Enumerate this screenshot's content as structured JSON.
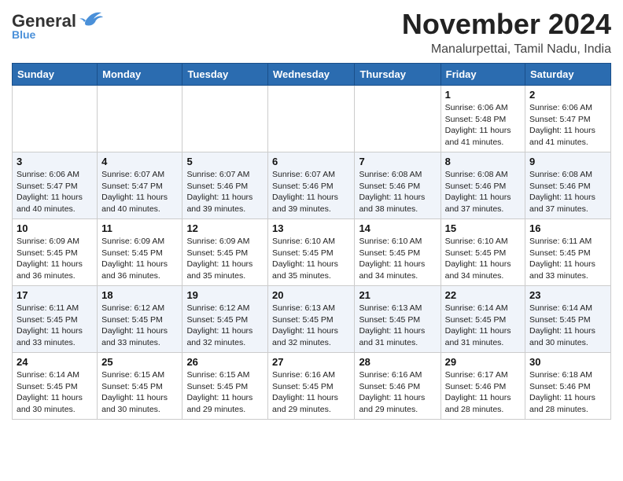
{
  "header": {
    "logo_general": "General",
    "logo_blue": "Blue",
    "month_title": "November 2024",
    "subtitle": "Manalurpettai, Tamil Nadu, India"
  },
  "days_of_week": [
    "Sunday",
    "Monday",
    "Tuesday",
    "Wednesday",
    "Thursday",
    "Friday",
    "Saturday"
  ],
  "weeks": [
    [
      {
        "day": "",
        "info": ""
      },
      {
        "day": "",
        "info": ""
      },
      {
        "day": "",
        "info": ""
      },
      {
        "day": "",
        "info": ""
      },
      {
        "day": "",
        "info": ""
      },
      {
        "day": "1",
        "info": "Sunrise: 6:06 AM\nSunset: 5:48 PM\nDaylight: 11 hours and 41 minutes."
      },
      {
        "day": "2",
        "info": "Sunrise: 6:06 AM\nSunset: 5:47 PM\nDaylight: 11 hours and 41 minutes."
      }
    ],
    [
      {
        "day": "3",
        "info": "Sunrise: 6:06 AM\nSunset: 5:47 PM\nDaylight: 11 hours and 40 minutes."
      },
      {
        "day": "4",
        "info": "Sunrise: 6:07 AM\nSunset: 5:47 PM\nDaylight: 11 hours and 40 minutes."
      },
      {
        "day": "5",
        "info": "Sunrise: 6:07 AM\nSunset: 5:46 PM\nDaylight: 11 hours and 39 minutes."
      },
      {
        "day": "6",
        "info": "Sunrise: 6:07 AM\nSunset: 5:46 PM\nDaylight: 11 hours and 39 minutes."
      },
      {
        "day": "7",
        "info": "Sunrise: 6:08 AM\nSunset: 5:46 PM\nDaylight: 11 hours and 38 minutes."
      },
      {
        "day": "8",
        "info": "Sunrise: 6:08 AM\nSunset: 5:46 PM\nDaylight: 11 hours and 37 minutes."
      },
      {
        "day": "9",
        "info": "Sunrise: 6:08 AM\nSunset: 5:46 PM\nDaylight: 11 hours and 37 minutes."
      }
    ],
    [
      {
        "day": "10",
        "info": "Sunrise: 6:09 AM\nSunset: 5:45 PM\nDaylight: 11 hours and 36 minutes."
      },
      {
        "day": "11",
        "info": "Sunrise: 6:09 AM\nSunset: 5:45 PM\nDaylight: 11 hours and 36 minutes."
      },
      {
        "day": "12",
        "info": "Sunrise: 6:09 AM\nSunset: 5:45 PM\nDaylight: 11 hours and 35 minutes."
      },
      {
        "day": "13",
        "info": "Sunrise: 6:10 AM\nSunset: 5:45 PM\nDaylight: 11 hours and 35 minutes."
      },
      {
        "day": "14",
        "info": "Sunrise: 6:10 AM\nSunset: 5:45 PM\nDaylight: 11 hours and 34 minutes."
      },
      {
        "day": "15",
        "info": "Sunrise: 6:10 AM\nSunset: 5:45 PM\nDaylight: 11 hours and 34 minutes."
      },
      {
        "day": "16",
        "info": "Sunrise: 6:11 AM\nSunset: 5:45 PM\nDaylight: 11 hours and 33 minutes."
      }
    ],
    [
      {
        "day": "17",
        "info": "Sunrise: 6:11 AM\nSunset: 5:45 PM\nDaylight: 11 hours and 33 minutes."
      },
      {
        "day": "18",
        "info": "Sunrise: 6:12 AM\nSunset: 5:45 PM\nDaylight: 11 hours and 33 minutes."
      },
      {
        "day": "19",
        "info": "Sunrise: 6:12 AM\nSunset: 5:45 PM\nDaylight: 11 hours and 32 minutes."
      },
      {
        "day": "20",
        "info": "Sunrise: 6:13 AM\nSunset: 5:45 PM\nDaylight: 11 hours and 32 minutes."
      },
      {
        "day": "21",
        "info": "Sunrise: 6:13 AM\nSunset: 5:45 PM\nDaylight: 11 hours and 31 minutes."
      },
      {
        "day": "22",
        "info": "Sunrise: 6:14 AM\nSunset: 5:45 PM\nDaylight: 11 hours and 31 minutes."
      },
      {
        "day": "23",
        "info": "Sunrise: 6:14 AM\nSunset: 5:45 PM\nDaylight: 11 hours and 30 minutes."
      }
    ],
    [
      {
        "day": "24",
        "info": "Sunrise: 6:14 AM\nSunset: 5:45 PM\nDaylight: 11 hours and 30 minutes."
      },
      {
        "day": "25",
        "info": "Sunrise: 6:15 AM\nSunset: 5:45 PM\nDaylight: 11 hours and 30 minutes."
      },
      {
        "day": "26",
        "info": "Sunrise: 6:15 AM\nSunset: 5:45 PM\nDaylight: 11 hours and 29 minutes."
      },
      {
        "day": "27",
        "info": "Sunrise: 6:16 AM\nSunset: 5:45 PM\nDaylight: 11 hours and 29 minutes."
      },
      {
        "day": "28",
        "info": "Sunrise: 6:16 AM\nSunset: 5:46 PM\nDaylight: 11 hours and 29 minutes."
      },
      {
        "day": "29",
        "info": "Sunrise: 6:17 AM\nSunset: 5:46 PM\nDaylight: 11 hours and 28 minutes."
      },
      {
        "day": "30",
        "info": "Sunrise: 6:18 AM\nSunset: 5:46 PM\nDaylight: 11 hours and 28 minutes."
      }
    ]
  ]
}
